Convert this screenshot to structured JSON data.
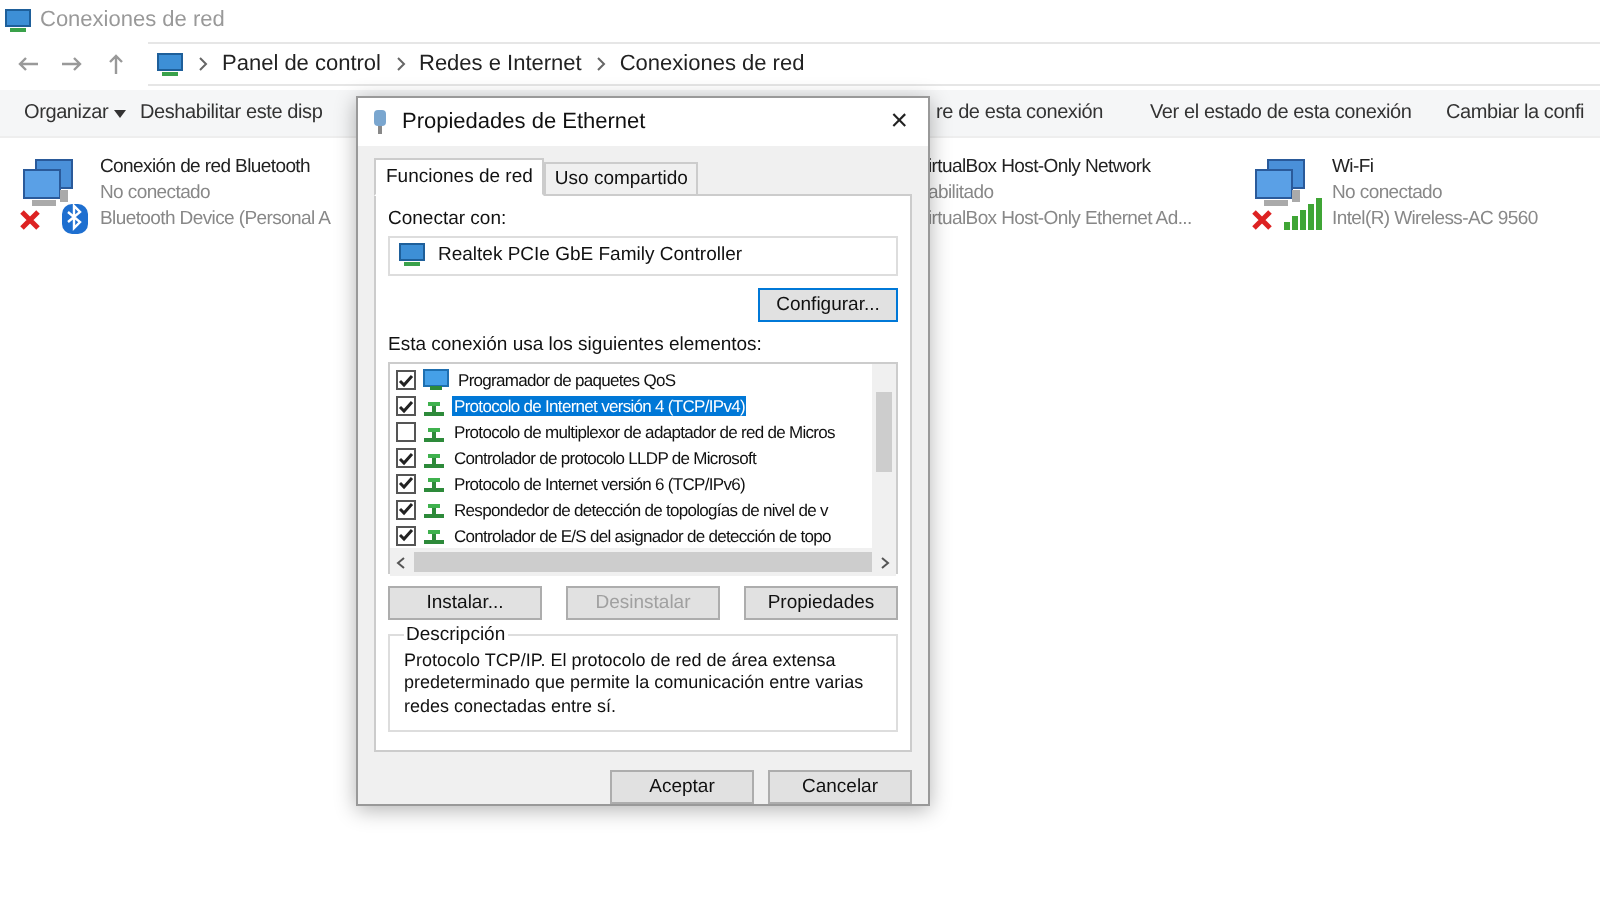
{
  "window": {
    "title": "Conexiones de red"
  },
  "address_bar": {
    "path": [
      {
        "label": "Panel de control"
      },
      {
        "label": "Redes e Internet"
      },
      {
        "label": "Conexiones de red"
      }
    ]
  },
  "command_bar": [
    {
      "label": "Organizar",
      "dropdown": true
    },
    {
      "label": "Deshabilitar este disp"
    },
    {
      "label": "re de esta conexión"
    },
    {
      "label": "Ver el estado de esta conexión"
    },
    {
      "label": "Cambiar la confi"
    }
  ],
  "connections": [
    {
      "name": "Conexión de red Bluetooth",
      "status": "No conectado",
      "device": "Bluetooth Device (Personal A",
      "kind": "bluetooth",
      "disconnected": true
    },
    {
      "name": "irtualBox Host-Only Network",
      "status": "abilitado",
      "device": "irtualBox Host-Only Ethernet Ad..."
    },
    {
      "name": "Wi-Fi",
      "status": "No conectado",
      "device": "Intel(R) Wireless-AC 9560",
      "kind": "wifi",
      "disconnected": true
    }
  ],
  "dialog": {
    "title": "Propiedades de Ethernet",
    "close": "×",
    "tabs": [
      {
        "label": "Funciones de red",
        "selected": true
      },
      {
        "label": "Uso compartido",
        "selected": false
      }
    ],
    "connect_label": "Conectar con:",
    "adapter": "Realtek PCIe GbE Family Controller",
    "configure_button": "Configurar...",
    "items_label": "Esta conexión usa los siguientes elementos:",
    "items": [
      {
        "label": "Programador de paquetes QoS",
        "checked": true,
        "selected": false,
        "kind": "scheduler"
      },
      {
        "label": "Protocolo de Internet versión 4 (TCP/IPv4)",
        "checked": true,
        "selected": true,
        "kind": "protocol"
      },
      {
        "label": "Protocolo de multiplexor de adaptador de red de Micros",
        "checked": false,
        "selected": false,
        "kind": "protocol"
      },
      {
        "label": "Controlador de protocolo LLDP de Microsoft",
        "checked": true,
        "selected": false,
        "kind": "protocol"
      },
      {
        "label": "Protocolo de Internet versión 6 (TCP/IPv6)",
        "checked": true,
        "selected": false,
        "kind": "protocol"
      },
      {
        "label": "Respondedor de detección de topologías de nivel de v",
        "checked": true,
        "selected": false,
        "kind": "protocol"
      },
      {
        "label": "Controlador de E/S del asignador de detección de topo",
        "checked": true,
        "selected": false,
        "kind": "protocol"
      }
    ],
    "item_buttons": [
      {
        "label": "Instalar...",
        "disabled": false
      },
      {
        "label": "Desinstalar",
        "disabled": true
      },
      {
        "label": "Propiedades",
        "disabled": false
      }
    ],
    "description": {
      "title": "Descripción",
      "text": "Protocolo TCP/IP. El protocolo de red de área extensa predeterminado que permite la comunicación entre varias redes conectadas entre sí."
    },
    "footer_buttons": [
      {
        "label": "Aceptar"
      },
      {
        "label": "Cancelar"
      }
    ]
  }
}
